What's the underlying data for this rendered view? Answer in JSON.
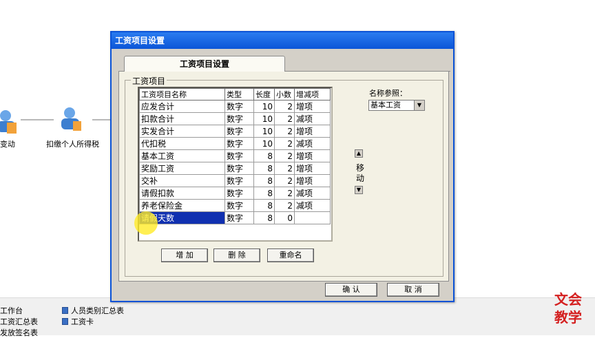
{
  "background": {
    "flow_items": [
      {
        "label": "变动"
      },
      {
        "label": "扣缴个人所得税"
      }
    ],
    "bottom_links": [
      {
        "label": "工作台"
      },
      {
        "label": "工资汇总表"
      },
      {
        "label": "发放签名表"
      },
      {
        "label": "人员类别汇总表"
      },
      {
        "label": "工资卡"
      }
    ],
    "brand": {
      "line1": "文会",
      "line2": "教学"
    }
  },
  "dialog": {
    "title": "工资项目设置",
    "tab_label": "工资项目设置",
    "group_label": "工资项目",
    "grid": {
      "columns": [
        "工资项目名称",
        "类型",
        "长度",
        "小数",
        "增减项"
      ],
      "rows": [
        {
          "name": "应发合计",
          "type": "数字",
          "length": "10",
          "decimals": "2",
          "direction": "增项"
        },
        {
          "name": "扣款合计",
          "type": "数字",
          "length": "10",
          "decimals": "2",
          "direction": "减项"
        },
        {
          "name": "实发合计",
          "type": "数字",
          "length": "10",
          "decimals": "2",
          "direction": "增项"
        },
        {
          "name": "代扣税",
          "type": "数字",
          "length": "10",
          "decimals": "2",
          "direction": "减项"
        },
        {
          "name": "基本工资",
          "type": "数字",
          "length": "8",
          "decimals": "2",
          "direction": "增项"
        },
        {
          "name": "奖励工资",
          "type": "数字",
          "length": "8",
          "decimals": "2",
          "direction": "增项"
        },
        {
          "name": "交补",
          "type": "数字",
          "length": "8",
          "decimals": "2",
          "direction": "增项"
        },
        {
          "name": "请假扣款",
          "type": "数字",
          "length": "8",
          "decimals": "2",
          "direction": "减项"
        },
        {
          "name": "养老保险金",
          "type": "数字",
          "length": "8",
          "decimals": "2",
          "direction": "减项"
        },
        {
          "name": "请假天数",
          "type": "数字",
          "length": "8",
          "decimals": "0",
          "direction": ""
        }
      ],
      "selected_row": 9
    },
    "move_label": "移动",
    "name_ref_label": "名称参照：",
    "name_ref_value": "基本工资",
    "buttons": {
      "add": "增 加",
      "delete": "删 除",
      "rename": "重命名",
      "ok": "确 认",
      "cancel": "取 消"
    }
  }
}
